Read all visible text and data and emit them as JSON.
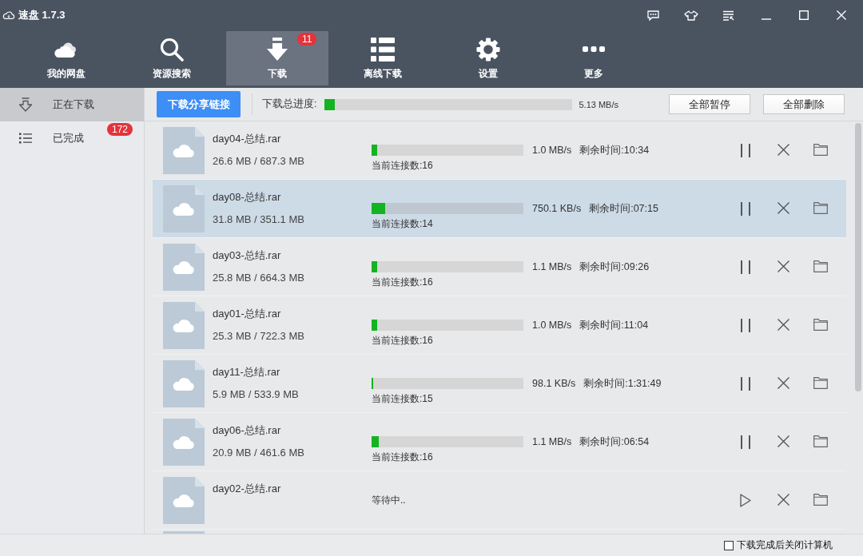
{
  "window": {
    "title": "速盘 1.7.3"
  },
  "nav": [
    {
      "label": "我的网盘",
      "selected": false
    },
    {
      "label": "资源搜索",
      "selected": false
    },
    {
      "label": "下载",
      "selected": true,
      "badge": "11"
    },
    {
      "label": "离线下载",
      "selected": false
    },
    {
      "label": "设置",
      "selected": false
    },
    {
      "label": "更多",
      "selected": false
    }
  ],
  "sidebar": {
    "items": [
      {
        "label": "正在下载",
        "selected": true
      },
      {
        "label": "已完成",
        "selected": false,
        "badge": "172"
      }
    ]
  },
  "toolbar": {
    "share_button": "下载分享链接",
    "progress": {
      "label": "下载总进度:",
      "level": 0.04,
      "reading": "5.13 MB/s"
    },
    "buttons": [
      "全部暂停",
      "全部删除"
    ]
  },
  "downloads": [
    {
      "kind": "active",
      "name": "day04-总结.rar",
      "size": "26.6 MB / 687.3 MB",
      "level": 0.039,
      "speed": "1.0 MB/s",
      "remaining": "剩余时间:10:34",
      "connections": "当前连接数:16",
      "selected": false
    },
    {
      "kind": "active",
      "name": "day08-总结.rar",
      "size": "31.8 MB / 351.1 MB",
      "level": 0.091,
      "speed": "750.1 KB/s",
      "remaining": "剩余时间:07:15",
      "connections": "当前连接数:14",
      "selected": true
    },
    {
      "kind": "active",
      "name": "day03-总结.rar",
      "size": "25.8 MB / 664.3 MB",
      "level": 0.039,
      "speed": "1.1 MB/s",
      "remaining": "剩余时间:09:26",
      "connections": "当前连接数:16",
      "selected": false
    },
    {
      "kind": "active",
      "name": "day01-总结.rar",
      "size": "25.3 MB / 722.3 MB",
      "level": 0.035,
      "speed": "1.0 MB/s",
      "remaining": "剩余时间:11:04",
      "connections": "当前连接数:16",
      "selected": false
    },
    {
      "kind": "active",
      "name": "day11-总结.rar",
      "size": "5.9 MB / 533.9 MB",
      "level": 0.011,
      "speed": "98.1 KB/s",
      "remaining": "剩余时间:1:31:49",
      "connections": "当前连接数:15",
      "selected": false
    },
    {
      "kind": "active",
      "name": "day06-总结.rar",
      "size": "20.9 MB / 461.6 MB",
      "level": 0.045,
      "speed": "1.1 MB/s",
      "remaining": "剩余时间:06:54",
      "connections": "当前连接数:16",
      "selected": false
    },
    {
      "kind": "waiting",
      "name": "day02-总结.rar",
      "status": "等待中..",
      "selected": false
    }
  ],
  "footer": {
    "checkbox": {
      "label": "下载完成后关闭计算机",
      "checked": false
    }
  }
}
